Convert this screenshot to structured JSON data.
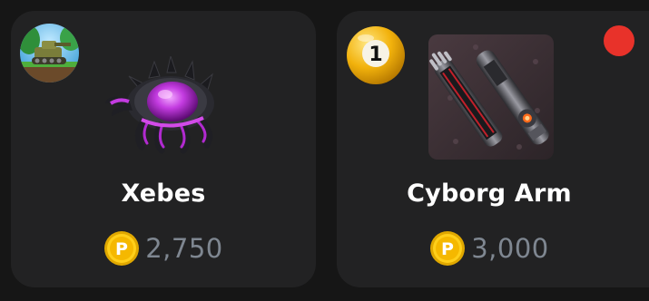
{
  "colors": {
    "page_background": "#161616",
    "card_background": "#222223",
    "item_name": "#ffffff",
    "price_text": "#7f8791",
    "coin_gold": "#f5c518",
    "notification_red": "#e8322a"
  },
  "items": [
    {
      "name": "Xebes",
      "price": "2,750",
      "currency_icon": "p-coin-icon",
      "game_icon": "tank-game-icon",
      "image": "purple-tentacle-creature"
    },
    {
      "name": "Cyborg Arm",
      "price": "3,000",
      "currency_icon": "p-coin-icon",
      "badge_icon": "billiard-ball-one-icon",
      "badge_text": "1",
      "image": "cyborg-arm-thumbnail",
      "notification": true
    }
  ]
}
